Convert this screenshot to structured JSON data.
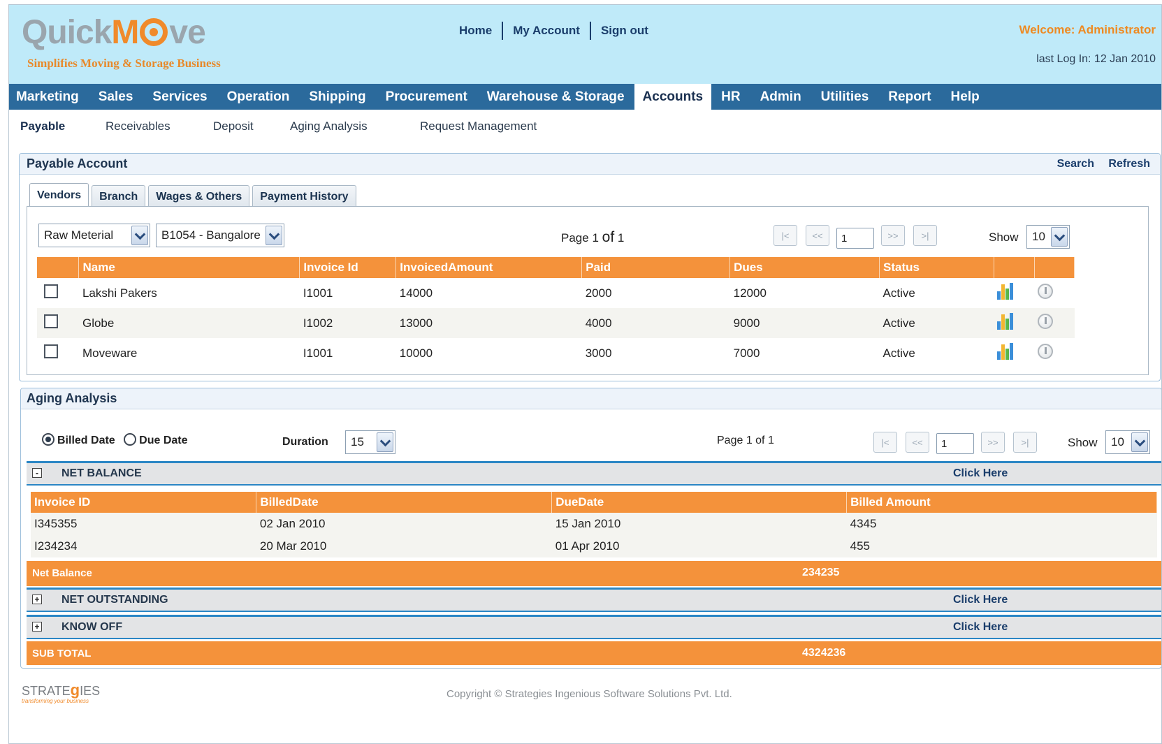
{
  "brand": {
    "name_pre": "Quick",
    "name_accent": "M",
    "name_post": "ve",
    "tagline": "Simplifies Moving & Storage Business"
  },
  "top_links": [
    "Home",
    "My Account",
    "Sign out"
  ],
  "user": {
    "welcome": "Welcome: Administrator",
    "last_login": "last Log In: 12 Jan 2010"
  },
  "main_nav": {
    "items": [
      "Marketing",
      "Sales",
      "Services",
      "Operation",
      "Shipping",
      "Procurement",
      "Warehouse & Storage",
      "Accounts",
      "HR",
      "Admin",
      "Utilities",
      "Report",
      "Help"
    ],
    "active": "Accounts"
  },
  "sub_nav": {
    "items": [
      "Payable",
      "Receivables",
      "Deposit",
      "Aging Analysis",
      "Request Management"
    ],
    "active": "Payable"
  },
  "payable": {
    "title": "Payable Account",
    "actions": [
      "Search",
      "Refresh"
    ],
    "tabs": [
      "Vendors",
      "Branch",
      "Wages & Others",
      "Payment History"
    ],
    "active_tab": "Vendors",
    "filter_type": "Raw Meterial",
    "filter_branch": "B1054 - Bangalore",
    "page_label": "Page",
    "page_current": "1",
    "page_of": "of",
    "page_total": "1",
    "pager": {
      "first": "|<",
      "prev": "<<",
      "next": ">>",
      "last": ">|",
      "input": "1"
    },
    "show_label": "Show",
    "show_value": "10",
    "columns": [
      "Name",
      "Invoice Id",
      "InvoicedAmount",
      "Paid",
      "Dues",
      "Status"
    ],
    "rows": [
      {
        "name": "Lakshi Pakers",
        "invoice": "I1001",
        "amount": "14000",
        "paid": "2000",
        "dues": "12000",
        "status": "Active"
      },
      {
        "name": "Globe",
        "invoice": "I1002",
        "amount": "13000",
        "paid": "4000",
        "dues": "9000",
        "status": "Active"
      },
      {
        "name": "Moveware",
        "invoice": "I1001",
        "amount": "10000",
        "paid": "3000",
        "dues": "7000",
        "status": "Active"
      }
    ]
  },
  "aging": {
    "title": "Aging Analysis",
    "radio_billed": "Billed Date",
    "radio_due": "Due Date",
    "duration_label": "Duration",
    "duration_value": "15",
    "page_text": "Page 1 of 1",
    "pager": {
      "first": "|<",
      "prev": "<<",
      "next": ">>",
      "last": ">|",
      "input": "1"
    },
    "show_label": "Show",
    "show_value": "10",
    "groups": [
      {
        "label": "NET BALANCE",
        "click": "Click Here",
        "expanded": "-"
      },
      {
        "label": "NET OUTSTANDING",
        "click": "Click Here",
        "expanded": "+"
      },
      {
        "label": "KNOW OFF",
        "click": "Click Here",
        "expanded": "+"
      }
    ],
    "columns": [
      "Invoice ID",
      "BilledDate",
      "DueDate",
      "Billed Amount"
    ],
    "rows": [
      {
        "id": "I345355",
        "billed": "02 Jan 2010",
        "due": "15 Jan 2010",
        "amount": "4345"
      },
      {
        "id": "I234234",
        "billed": "20 Mar 2010",
        "due": "01 Apr 2010",
        "amount": "455"
      }
    ],
    "net_balance_label": "Net Balance",
    "net_balance_value": "234235",
    "subtotal_label": "SUB TOTAL",
    "subtotal_value": "4324236"
  },
  "footer": {
    "logo_pre": "STRATE",
    "logo_accent": "g",
    "logo_post": "IES",
    "logo_tag": "transforming your business",
    "copyright": "Copyright © Strategies Ingenious Software Solutions Pvt. Ltd."
  },
  "colors": {
    "header_bg": "#bfeaf9",
    "nav_bg": "#2b6a9c",
    "accent": "#f4923b",
    "group_border": "#2b86c5"
  }
}
